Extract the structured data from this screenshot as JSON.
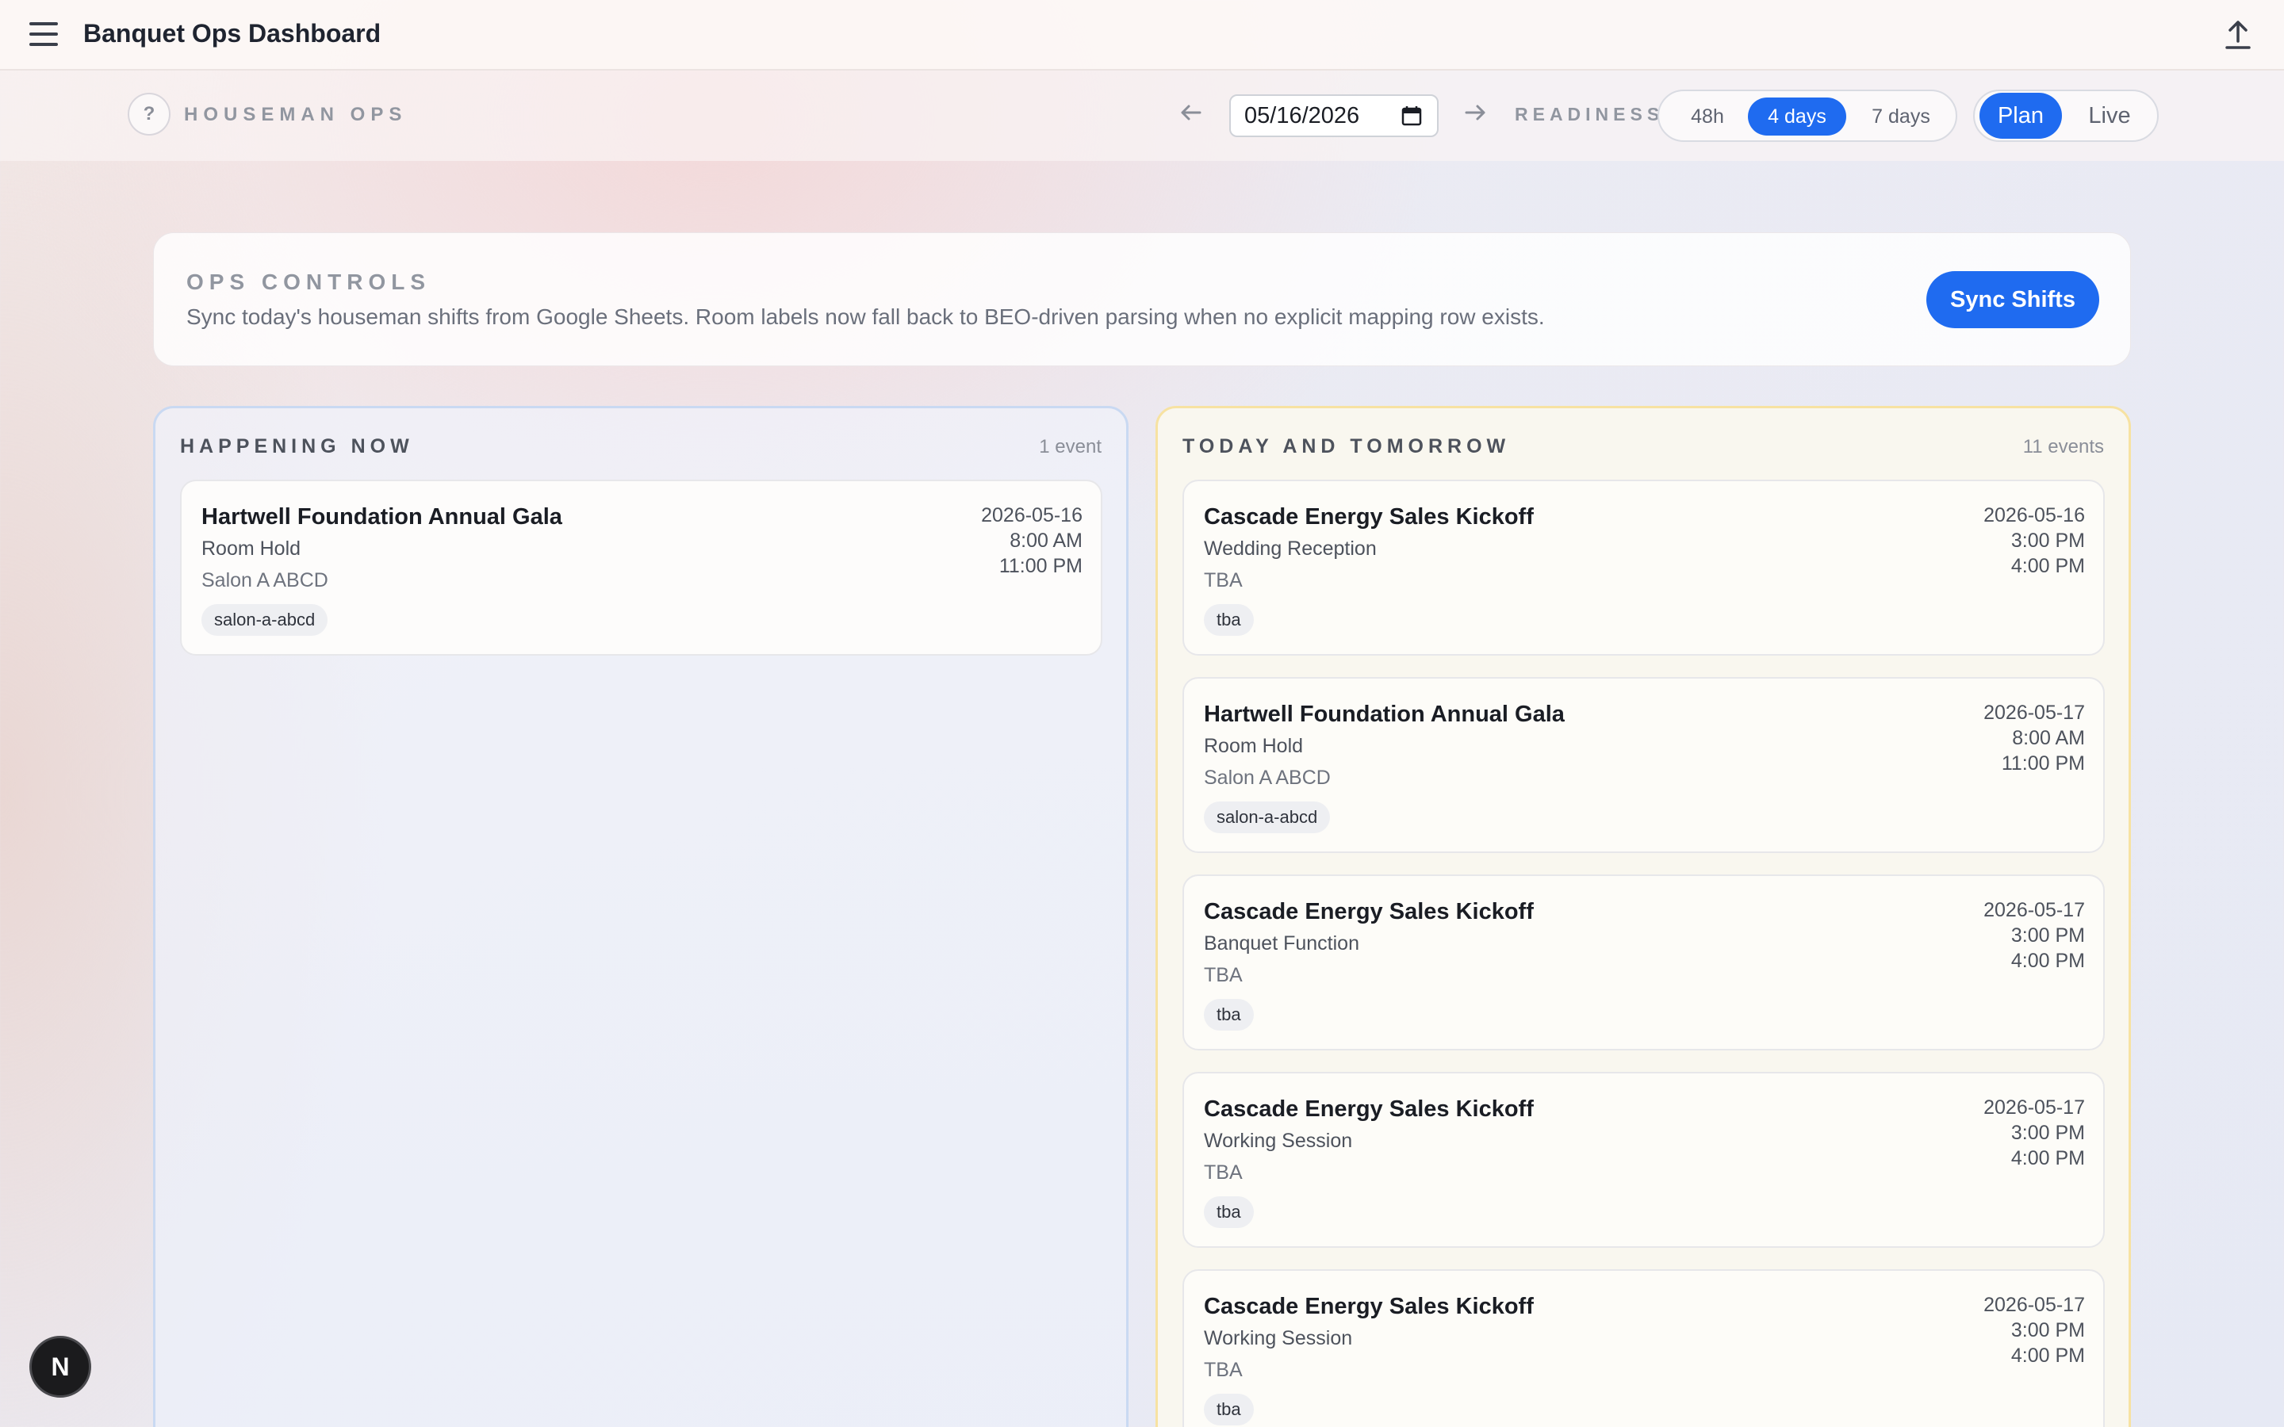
{
  "app": {
    "title": "Banquet Ops Dashboard"
  },
  "toolbar": {
    "help_label": "?",
    "section_label": "HOUSEMAN OPS",
    "date_value": "05/16/2026",
    "readiness_label": "READINESS",
    "range_options": [
      {
        "label": "48h",
        "active": false
      },
      {
        "label": "4 days",
        "active": true
      },
      {
        "label": "7 days",
        "active": false
      }
    ],
    "mode_options": [
      {
        "label": "Plan",
        "active": true
      },
      {
        "label": "Live",
        "active": false
      }
    ]
  },
  "controls": {
    "title": "OPS CONTROLS",
    "description": "Sync today's houseman shifts from Google Sheets. Room labels now fall back to BEO-driven parsing when no explicit mapping row exists.",
    "sync_label": "Sync Shifts"
  },
  "happening_now": {
    "title": "HAPPENING NOW",
    "count": "1 event",
    "events": [
      {
        "name": "Hartwell Foundation Annual Gala",
        "type": "Room Hold",
        "room": "Salon A ABCD",
        "tag": "salon-a-abcd",
        "date": "2026-05-16",
        "start": "8:00 AM",
        "end": "11:00 PM"
      }
    ]
  },
  "today_tomorrow": {
    "title": "TODAY AND TOMORROW",
    "count": "11 events",
    "events": [
      {
        "name": "Cascade Energy Sales Kickoff",
        "type": "Wedding Reception",
        "room": "TBA",
        "tag": "tba",
        "date": "2026-05-16",
        "start": "3:00 PM",
        "end": "4:00 PM"
      },
      {
        "name": "Hartwell Foundation Annual Gala",
        "type": "Room Hold",
        "room": "Salon A ABCD",
        "tag": "salon-a-abcd",
        "date": "2026-05-17",
        "start": "8:00 AM",
        "end": "11:00 PM"
      },
      {
        "name": "Cascade Energy Sales Kickoff",
        "type": "Banquet Function",
        "room": "TBA",
        "tag": "tba",
        "date": "2026-05-17",
        "start": "3:00 PM",
        "end": "4:00 PM"
      },
      {
        "name": "Cascade Energy Sales Kickoff",
        "type": "Working Session",
        "room": "TBA",
        "tag": "tba",
        "date": "2026-05-17",
        "start": "3:00 PM",
        "end": "4:00 PM"
      },
      {
        "name": "Cascade Energy Sales Kickoff",
        "type": "Working Session",
        "room": "TBA",
        "tag": "tba",
        "date": "2026-05-17",
        "start": "3:00 PM",
        "end": "4:00 PM"
      }
    ]
  },
  "dev_badge": {
    "label": "N"
  },
  "colors": {
    "accent": "#1f6bf0",
    "now_border": "#c9d9f2",
    "tt_border": "#f7e2a2"
  },
  "icons": [
    "menu-icon",
    "upload-icon",
    "arrow-left-icon",
    "arrow-right-icon",
    "calendar-icon"
  ]
}
